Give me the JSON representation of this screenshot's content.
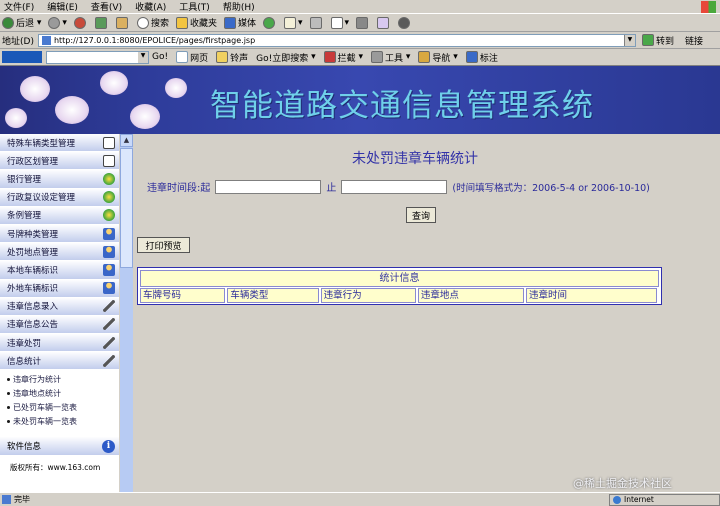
{
  "menubar": {
    "items": [
      "文件(F)",
      "编辑(E)",
      "查看(V)",
      "收藏(A)",
      "工具(T)",
      "帮助(H)"
    ]
  },
  "toolbar": {
    "back": "后退",
    "search": "搜索",
    "favorites": "收藏夹",
    "media": "媒体"
  },
  "addressbar": {
    "label": "地址(D)",
    "url": "http://127.0.0.1:8080/EPOLICE/pages/firstpage.jsp",
    "go": "转到",
    "links": "链接"
  },
  "linksbar": {
    "go1": "Go!",
    "web": "网页",
    "ring": "铃声",
    "go2": "Go!立即搜索",
    "intercept": "拦截",
    "tools": "工具",
    "nav": "导航",
    "mark": "标注"
  },
  "banner": {
    "title": "智能道路交通信息管理系统"
  },
  "sidebar": {
    "items": [
      {
        "label": "特殊车辆类型管理",
        "icon": "edit-icon"
      },
      {
        "label": "行政区划管理",
        "icon": "edit-icon"
      },
      {
        "label": "银行管理",
        "icon": "globe-icon"
      },
      {
        "label": "行政复议设定管理",
        "icon": "globe-icon"
      },
      {
        "label": "条例管理",
        "icon": "globe-icon"
      },
      {
        "label": "号牌种类管理",
        "icon": "person-icon"
      },
      {
        "label": "处罚地点管理",
        "icon": "person-icon"
      },
      {
        "label": "本地车辆标识",
        "icon": "person-icon"
      },
      {
        "label": "外地车辆标识",
        "icon": "person-icon"
      },
      {
        "label": "违章信息录入",
        "icon": "tool-icon"
      },
      {
        "label": "违章信息公告",
        "icon": "tool-icon"
      },
      {
        "label": "违章处罚",
        "icon": "tool-icon"
      },
      {
        "label": "信息统计",
        "icon": "tool-icon"
      }
    ],
    "sub_items": [
      "违章行为统计",
      "违章地点统计",
      "已处罚车辆一览表",
      "未处罚车辆一览表"
    ],
    "software_info": "软件信息",
    "copyright": "版权所有：www.163.com"
  },
  "main": {
    "title": "未处罚违章车辆统计",
    "date_label": "违章时间段:起",
    "to_label": "止",
    "format_hint": "(时间填写格式为：2006-5-4 or 2006-10-10)",
    "query_btn": "查询",
    "print_btn": "打印预览",
    "stat_header": "统计信息",
    "columns": [
      "车牌号码",
      "车辆类型",
      "违章行为",
      "违章地点",
      "违章时间"
    ]
  },
  "statusbar": {
    "text": "完毕",
    "zone": "Internet"
  },
  "watermark": "@稀土掘金技术社区",
  "colors": {
    "banner": "#2e3c9a",
    "title_text": "#3333a8",
    "header_fill": "#fffecc"
  }
}
